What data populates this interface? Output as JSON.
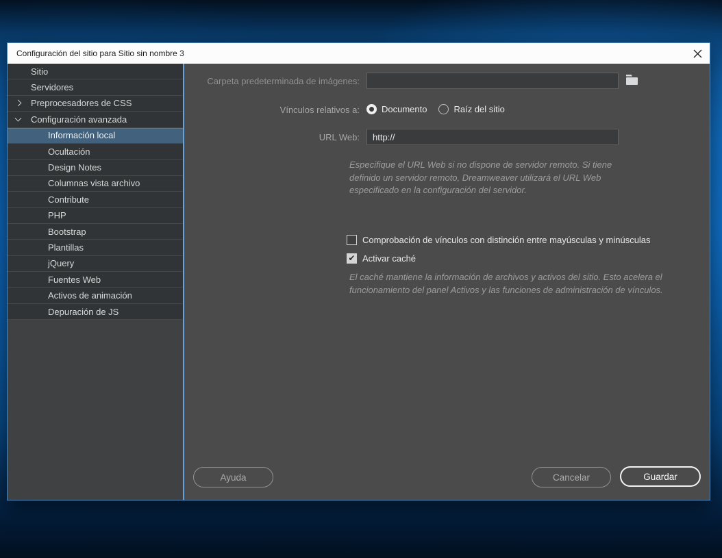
{
  "window": {
    "title": "Configuración del sitio para Sitio sin nombre 3"
  },
  "colors": {
    "accent_border": "#4e86b8",
    "divider_blue": "#66a3d9",
    "selected_item_bg": "#42617d",
    "titlebar_bg": "#fcfcfc",
    "panel_bg": "#4b4b4b",
    "sidebar_bg": "#3f4142"
  },
  "icons": {
    "close": "close-icon (x)",
    "folder": "folder-icon",
    "chevron_right": "chevron-right-icon",
    "chevron_down": "chevron-down-icon"
  },
  "sidebar": {
    "items": [
      {
        "label": "Sitio",
        "level": 1,
        "chevron": "none",
        "selected": false
      },
      {
        "label": "Servidores",
        "level": 1,
        "chevron": "none",
        "selected": false
      },
      {
        "label": "Preprocesadores de CSS",
        "level": 1,
        "chevron": "right",
        "selected": false
      },
      {
        "label": "Configuración avanzada",
        "level": 1,
        "chevron": "down",
        "selected": false
      },
      {
        "label": "Información local",
        "level": 2,
        "chevron": "none",
        "selected": true
      },
      {
        "label": "Ocultación",
        "level": 2,
        "chevron": "none",
        "selected": false
      },
      {
        "label": "Design Notes",
        "level": 2,
        "chevron": "none",
        "selected": false
      },
      {
        "label": "Columnas vista archivo",
        "level": 2,
        "chevron": "none",
        "selected": false
      },
      {
        "label": "Contribute",
        "level": 2,
        "chevron": "none",
        "selected": false
      },
      {
        "label": "PHP",
        "level": 2,
        "chevron": "none",
        "selected": false
      },
      {
        "label": "Bootstrap",
        "level": 2,
        "chevron": "none",
        "selected": false
      },
      {
        "label": "Plantillas",
        "level": 2,
        "chevron": "none",
        "selected": false
      },
      {
        "label": "jQuery",
        "level": 2,
        "chevron": "none",
        "selected": false
      },
      {
        "label": "Fuentes Web",
        "level": 2,
        "chevron": "none",
        "selected": false
      },
      {
        "label": "Activos de animación",
        "level": 2,
        "chevron": "none",
        "selected": false
      },
      {
        "label": "Depuración de JS",
        "level": 2,
        "chevron": "none",
        "selected": false
      }
    ]
  },
  "form": {
    "default_images_label": "Carpeta predeterminada de imágenes:",
    "default_images_value": "",
    "links_relative_label": "Vínculos relativos a:",
    "links_options": [
      {
        "label": "Documento",
        "selected": true
      },
      {
        "label": "Raíz del sitio",
        "selected": false
      }
    ],
    "web_url_label": "URL Web:",
    "web_url_value": "http://",
    "web_url_help": "Especifique el URL Web si no dispone de servidor remoto. Si tiene definido un servidor remoto, Dreamweaver utilizará el URL Web especificado en la configuración del servidor.",
    "case_check_label": "Comprobación de vínculos con distinción entre mayúsculas y minúsculas",
    "case_check_checked": false,
    "cache_label": "Activar caché",
    "cache_checked": true,
    "cache_check_glyph": "✔",
    "cache_help": "El caché mantiene la información de archivos y activos del sitio. Esto acelera el funcionamiento del panel Activos y las funciones de administración de vínculos."
  },
  "buttons": {
    "help": "Ayuda",
    "cancel": "Cancelar",
    "save": "Guardar"
  }
}
